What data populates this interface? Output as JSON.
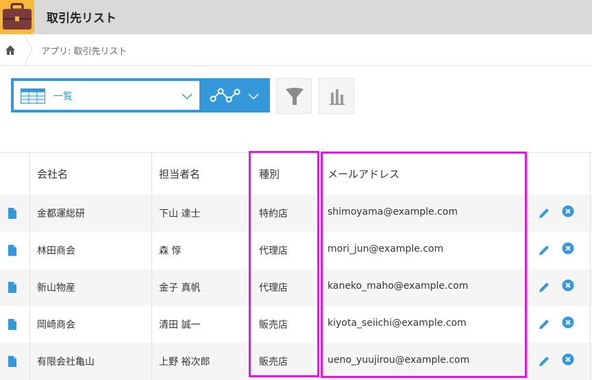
{
  "app": {
    "title": "取引先リスト",
    "icon": "briefcase-icon"
  },
  "breadcrumb": {
    "home_icon": "home-icon",
    "path": "アプリ: 取引先リスト"
  },
  "toolbar": {
    "view_label": "一覧",
    "view_icon": "table-icon",
    "graph_icon": "graph-icon",
    "filter_icon": "filter-icon",
    "chart_icon": "bar-chart-icon"
  },
  "table": {
    "columns": [
      "会社名",
      "担当者名",
      "種別",
      "メールアドレス"
    ],
    "rows": [
      {
        "company": "金都運総研",
        "contact": "下山 達士",
        "type": "特約店",
        "email": "shimoyama@example.com"
      },
      {
        "company": "林田商会",
        "contact": "森 惇",
        "type": "代理店",
        "email": "mori_jun@example.com"
      },
      {
        "company": "新山物産",
        "contact": "金子 真帆",
        "type": "代理店",
        "email": "kaneko_maho@example.com"
      },
      {
        "company": "岡崎商会",
        "contact": "清田 誠一",
        "type": "販売店",
        "email": "kiyota_seiichi@example.com"
      },
      {
        "company": "有限会社亀山",
        "contact": "上野 裕次郎",
        "type": "販売店",
        "email": "ueno_yuujirou@example.com"
      }
    ]
  },
  "colors": {
    "accent": "#3498db",
    "highlight": "#ee11ee",
    "header_bg": "#d9d9d9",
    "row_alt": "#f5f5f5"
  }
}
